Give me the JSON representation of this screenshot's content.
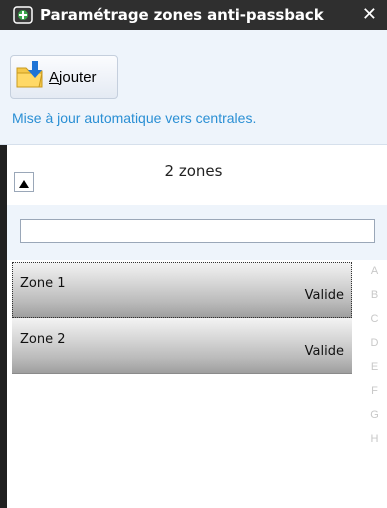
{
  "window": {
    "title": "Paramétrage zones anti-passback",
    "close_label": "✕",
    "icon": "zone-settings-icon"
  },
  "toolbar": {
    "add_label_first": "A",
    "add_label_rest": "jouter",
    "add_icon": "folder-add-icon"
  },
  "status": {
    "text": "Mise à jour automatique vers centrales."
  },
  "list": {
    "count": "2 zones",
    "filter_value": "",
    "sort_icon": "triangle-up-icon",
    "items": [
      {
        "name": "Zone 1",
        "status": "Valide"
      },
      {
        "name": "Zone 2",
        "status": "Valide"
      }
    ]
  },
  "alphabet": [
    "A",
    "B",
    "C",
    "D",
    "E",
    "F",
    "G",
    "H"
  ],
  "colors": {
    "titlebar": "#2f2f2f",
    "accent": "#2a8fd4",
    "toolbar_bg": "#eef4fb"
  }
}
